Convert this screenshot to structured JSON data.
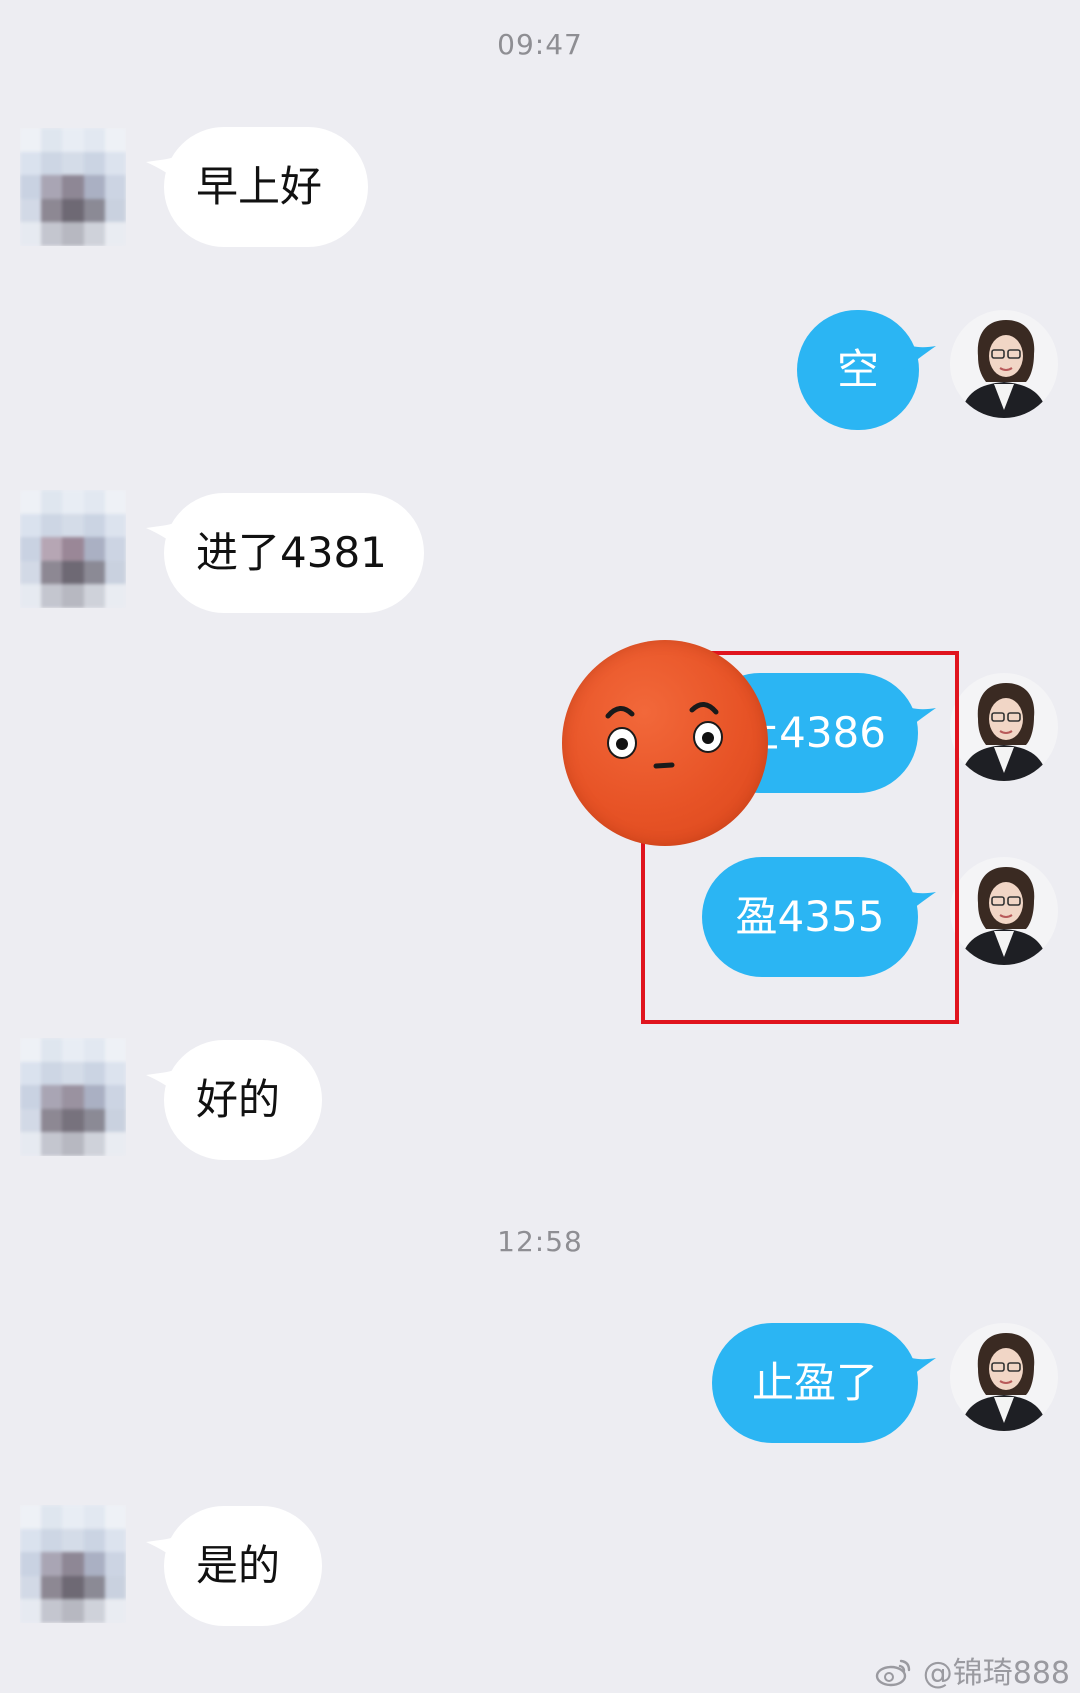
{
  "conversation": {
    "timestamps": [
      "09:47",
      "12:58"
    ],
    "messages": [
      {
        "side": "in",
        "text": "早上好"
      },
      {
        "side": "out",
        "text": "空"
      },
      {
        "side": "in",
        "text": "进了4381"
      },
      {
        "side": "out",
        "text": "止4386",
        "partially_covered_by": "orange-face-sticker"
      },
      {
        "side": "out",
        "text": "盈4355"
      },
      {
        "side": "in",
        "text": "好的"
      },
      {
        "side": "out",
        "text": "止盈了"
      },
      {
        "side": "in",
        "text": "是的"
      }
    ]
  },
  "watermark": {
    "text": "@锦琦888",
    "icon": "weibo-icon"
  },
  "colors": {
    "background": "#ededf2",
    "incoming_bubble": "#ffffff",
    "outgoing_bubble": "#2bb5f3",
    "highlight_box": "#e0141e",
    "sticker": "#e75326"
  }
}
